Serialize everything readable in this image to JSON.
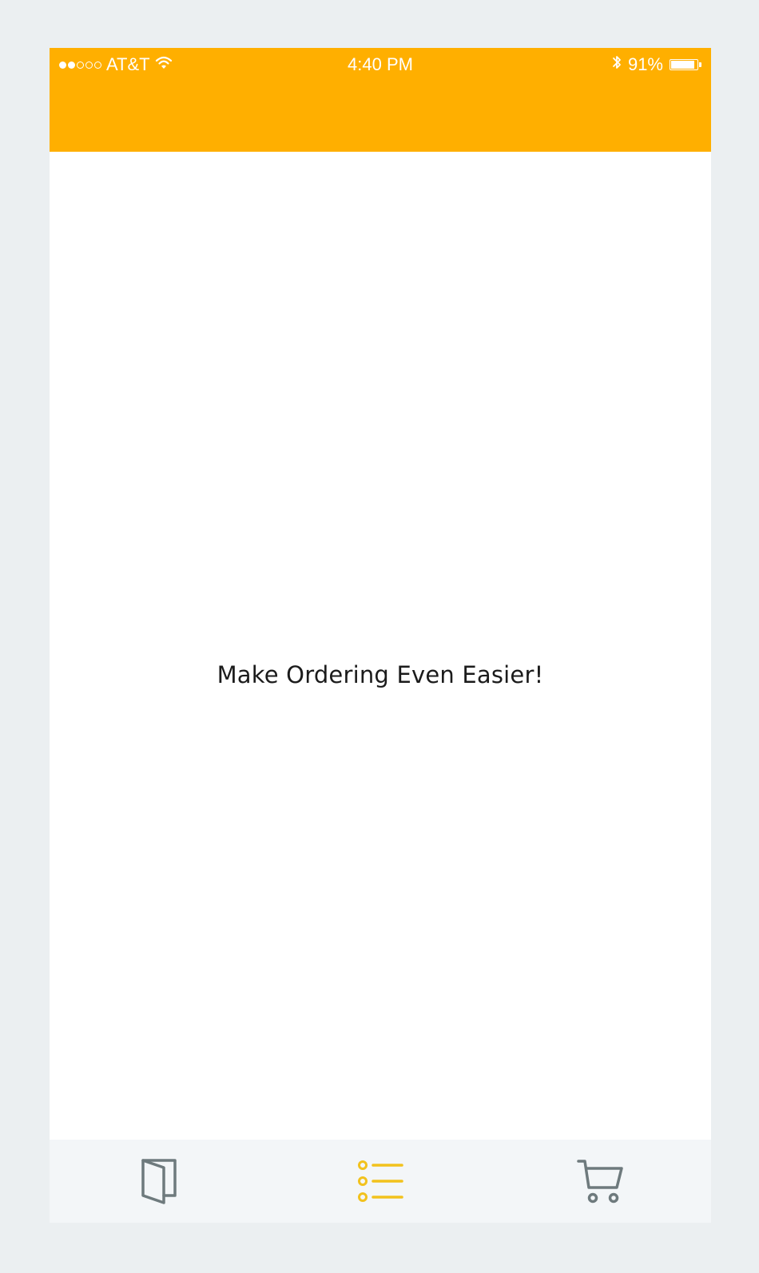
{
  "status_bar": {
    "carrier": "AT&T",
    "time": "4:40 PM",
    "battery_percent": "91%",
    "battery_level": 0.91,
    "signal_bars_filled": 2,
    "signal_bars_total": 5
  },
  "main": {
    "headline": "Make Ordering Even Easier!"
  },
  "tab_bar": {
    "tabs": [
      {
        "icon": "menu-book-icon",
        "active": false
      },
      {
        "icon": "list-icon",
        "active": true
      },
      {
        "icon": "cart-icon",
        "active": false
      }
    ]
  },
  "colors": {
    "accent": "#ffaf00",
    "active_tab": "#f2c21d",
    "inactive_tab": "#6e7a7d",
    "page_background": "#ebeff1",
    "tab_bar_background": "#f3f6f8"
  }
}
